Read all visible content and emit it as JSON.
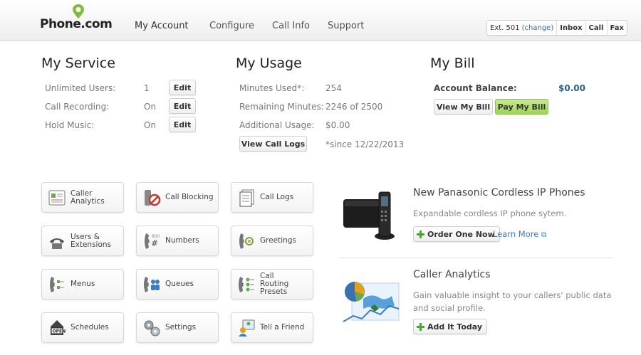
{
  "header": {
    "logo_text": "Phone.com",
    "nav": [
      "My Account",
      "Configure",
      "Call Info",
      "Support"
    ],
    "ext_label": "Ext. 501",
    "ext_change": "(change)",
    "inbox": "Inbox",
    "call": "Call",
    "fax": "Fax"
  },
  "service": {
    "title": "My Service",
    "rows": [
      {
        "label": "Unlimited Users:",
        "value": "1",
        "button": "Edit"
      },
      {
        "label": "Call Recording:",
        "value": "On",
        "button": "Edit"
      },
      {
        "label": "Hold Music:",
        "value": "On",
        "button": "Edit"
      }
    ]
  },
  "usage": {
    "title": "My Usage",
    "rows": [
      {
        "label": "Minutes Used*:",
        "value": "254"
      },
      {
        "label": "Remaining Minutes:",
        "value": "2246 of 2500"
      },
      {
        "label": "Additional Usage:",
        "value": "$0.00"
      }
    ],
    "button": "View Call Logs",
    "note": "*since 12/22/2013"
  },
  "bill": {
    "title": "My Bill",
    "balance_label": "Account Balance:",
    "balance_value": "$0.00",
    "view_button": "View My Bill",
    "pay_button": "Pay My Bill"
  },
  "tiles": [
    {
      "label": "Caller Analytics",
      "icon": "caller-analytics-icon"
    },
    {
      "label": "Call Blocking",
      "icon": "call-blocking-icon"
    },
    {
      "label": "Call Logs",
      "icon": "call-logs-icon"
    },
    {
      "label": "Users & Extensions",
      "icon": "users-phone-icon"
    },
    {
      "label": "Numbers",
      "icon": "numbers-icon"
    },
    {
      "label": "Greetings",
      "icon": "greetings-icon"
    },
    {
      "label": "Menus",
      "icon": "menus-icon"
    },
    {
      "label": "Queues",
      "icon": "queues-icon"
    },
    {
      "label": "Call Routing Presets",
      "icon": "call-routing-icon"
    },
    {
      "label": "Schedules",
      "icon": "schedules-icon"
    },
    {
      "label": "Settings",
      "icon": "settings-icon"
    },
    {
      "label": "Tell a Friend",
      "icon": "tell-a-friend-icon"
    }
  ],
  "promos": [
    {
      "title": "New Panasonic Cordless IP Phones",
      "desc": "Expandable cordless IP phone sytem.",
      "button": "Order One Now",
      "link": "Learn More"
    },
    {
      "title": "Caller Analytics",
      "desc": "Gain valuable insight to your callers' public data and social profile.",
      "button": "Add It Today"
    }
  ]
}
